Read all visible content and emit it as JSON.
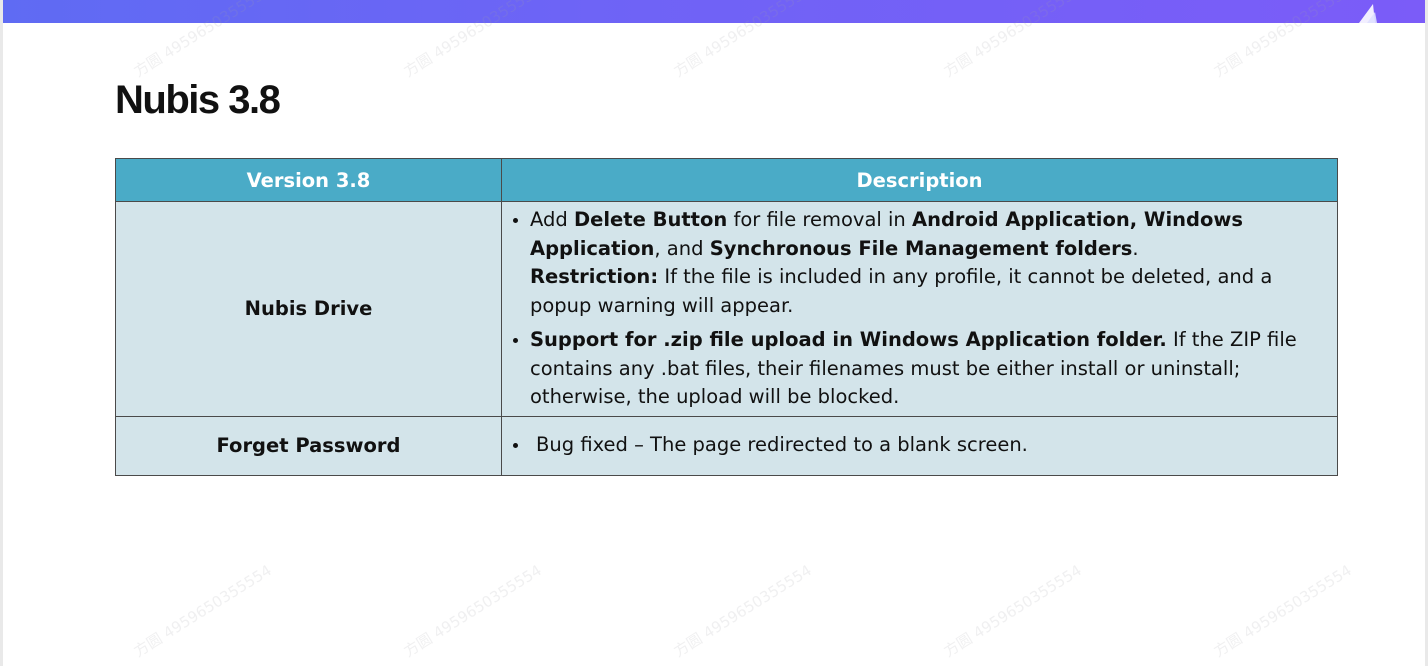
{
  "slide": {
    "title": "Nubis 3.8",
    "watermark_text": "方圆 4959650355554",
    "header_color": "#4aabc7",
    "row_color": "#d3e4ea",
    "top_bar_color": "#6f63f6"
  },
  "table": {
    "headers": {
      "feature": "Version 3.8",
      "description": "Description"
    },
    "rows": [
      {
        "feature": "Nubis Drive",
        "item1": {
          "p1": "Add ",
          "b1": "Delete Button",
          "p2": " for file removal in ",
          "b2": "Android Application, Windows Application",
          "p3": ", and ",
          "b3": "Synchronous File Management folders",
          "p4": ".",
          "restriction_label": "Restriction:",
          "restriction_text": " If the file is included in any profile, it cannot be deleted, and a popup warning will appear."
        },
        "item2": {
          "b1": "Support for .zip file upload in Windows Application folder.",
          "p1": " If the ZIP file contains any .bat files, their filenames must be either install or uninstall; otherwise, the upload will be blocked."
        }
      },
      {
        "feature": "Forget Password",
        "item1": "Bug fixed – The page redirected to a blank screen."
      }
    ]
  }
}
